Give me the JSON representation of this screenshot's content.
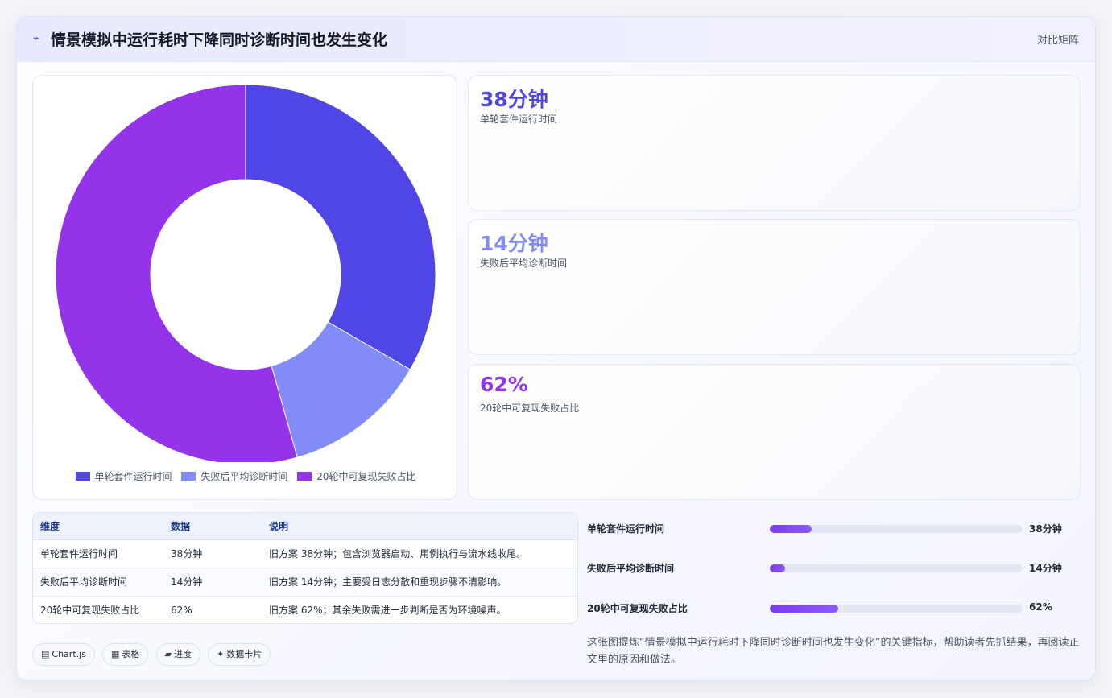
{
  "header": {
    "icon": "⌁",
    "title": "情景模拟中运行耗时下降同时诊断时间也发生变化",
    "view_label": "对比矩阵"
  },
  "chart_data": {
    "type": "pie",
    "categories": [
      "单轮套件运行时间",
      "失败后平均诊断时间",
      "20轮中可复现失败占比"
    ],
    "values": [
      38,
      14,
      62
    ],
    "colors": [
      "#4f46e5",
      "#818cf8",
      "#9333ea"
    ],
    "legend_position": "bottom"
  },
  "stats": [
    {
      "value": "38分钟",
      "label": "单轮套件运行时间",
      "color": "#4f46e5"
    },
    {
      "value": "14分钟",
      "label": "失败后平均诊断时间",
      "color": "#818cf8"
    },
    {
      "value": "62%",
      "label": "20轮中可复现失败占比",
      "color": "#9333ea"
    }
  ],
  "table": {
    "headers": [
      "维度",
      "数据",
      "说明"
    ],
    "rows": [
      [
        "单轮套件运行时间",
        "38分钟",
        "旧方案 38分钟；包含浏览器启动、用例执行与流水线收尾。"
      ],
      [
        "失败后平均诊断时间",
        "14分钟",
        "旧方案 14分钟；主要受日志分散和重现步骤不清影响。"
      ],
      [
        "20轮中可复现失败占比",
        "62%",
        "旧方案 62%；其余失败需进一步判断是否为环境噪声。"
      ]
    ]
  },
  "progress": [
    {
      "label": "单轮套件运行时间",
      "value": "38分钟",
      "fill": 0.165
    },
    {
      "label": "失败后平均诊断时间",
      "value": "14分钟",
      "fill": 0.06
    },
    {
      "label": "20轮中可复现失败占比",
      "value": "62%",
      "fill": 0.27
    }
  ],
  "note": "这张图提炼“情景模拟中运行耗时下降同时诊断时间也发生变化”的关键指标，帮助读者先抓结果，再阅读正文里的原因和做法。",
  "tags": [
    {
      "icon": "▤",
      "label": "Chart.js"
    },
    {
      "icon": "▦",
      "label": "表格"
    },
    {
      "icon": "▰",
      "label": "进度"
    },
    {
      "icon": "✦",
      "label": "数据卡片"
    }
  ]
}
